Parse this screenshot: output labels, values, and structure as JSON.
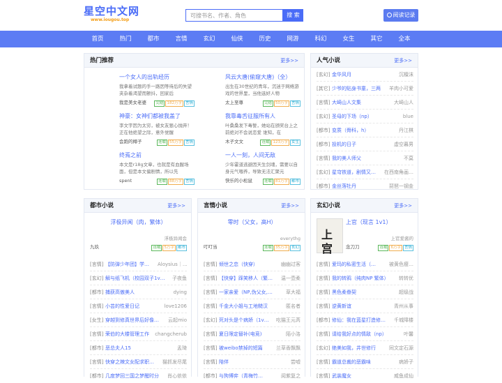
{
  "header": {
    "logo_title": "星空中文网",
    "logo_url": "www.iougou.top",
    "search_placeholder": "可搜书名、作者、角色",
    "search_button": "搜 索",
    "read_record": "阅读记录"
  },
  "nav": [
    "首页",
    "热门",
    "都市",
    "言情",
    "玄幻",
    "仙侠",
    "历史",
    "网游",
    "科幻",
    "女生",
    "其它",
    "全本"
  ],
  "hot": {
    "title": "热门推荐",
    "more": "更多>>",
    "items": [
      {
        "title": "一个女人的出轨经历",
        "desc": "我拿着试题的手一路因等待后的失望夹杂着渴望而颤抖，回家后",
        "author": "我是美女老婆",
        "tags": [
          "完结",
          "182万字",
          "言情"
        ]
      },
      {
        "title": "风云大唐(偷窥大唐)（全）",
        "desc": "出生在30世纪的青年，沉迷于网络游戏的世界里，当他选好人物",
        "author": "太上至尊",
        "tags": [
          "完结",
          "50万字",
          "言情"
        ]
      },
      {
        "title": "神豪：女神们都被我盖了",
        "desc": "李文宇因为太穷，被女友狠心抛弃！ 正在他绝望之际，意外觉醒",
        "author": "会跑的椰子",
        "tags": [
          "连载",
          "55万字",
          "言情"
        ]
      },
      {
        "title": "我靠毒舌征服所有人",
        "desc": "叶桑桑发下毒誓，她站在颁奖台上之前绝对不会说恋爱 谁知，在",
        "author": "木子文文",
        "tags": [
          "连载",
          "123万字",
          "女生"
        ]
      },
      {
        "title": "终焉之前",
        "desc": "本文是r18g文章，也就是有血腥场面，但是本文偏剧情，所以先",
        "author": "spent",
        "tags": [
          "连载",
          "88万字",
          "言情"
        ]
      },
      {
        "title": "一人一刻，人间无敌",
        "desc": "少年霍道逃避因天生剑魂，需要以自身元气喂养，导致无法汇聚元",
        "author": "快乐的小松鼠",
        "tags": [
          "连载",
          "81万字",
          "都市"
        ]
      }
    ]
  },
  "popular": {
    "title": "人气小说",
    "more": "更多>>",
    "items": [
      {
        "cat": "[玄幻]",
        "name": "金华风月",
        "author": "沉檀沫"
      },
      {
        "cat": "[其它]",
        "name": "少爷的贴身书童，三两",
        "author": "羊肉小可爱"
      },
      {
        "cat": "[言情]",
        "name": "大崎山人文集",
        "author": "大崎山人"
      },
      {
        "cat": "[玄幻]",
        "name": "圣母的下场（np）",
        "author": "blue"
      },
      {
        "cat": "[都市]",
        "name": "变质（骨科，h）",
        "author": "丹江棋"
      },
      {
        "cat": "[都市]",
        "name": "投机的日子",
        "author": "虚空暮男"
      },
      {
        "cat": "[言情]",
        "name": "我的美人师父",
        "author": "不莫"
      },
      {
        "cat": "[玄幻]",
        "name": "星穹铁道，剧情又…",
        "author": "在西南角画…"
      },
      {
        "cat": "[都市]",
        "name": "金丝落牡丹",
        "author": "琵琶一钢金"
      }
    ]
  },
  "urban": {
    "title": "都市小说",
    "more": "更多>>",
    "top_title": "浮极异闻（肉，繁体）",
    "top_author_right": "浮极异闻会",
    "top_author": "九玖",
    "top_tags": [
      "连载",
      "5万字",
      "都市"
    ],
    "items": [
      {
        "cat": "[言情]",
        "name": "【防弹少年团】学…",
        "author": "Aloysius｜…"
      },
      {
        "cat": "[玄幻]",
        "name": "解与纸飞机（校园双子1v…",
        "author": "子夜鱼"
      },
      {
        "cat": "[都市]",
        "name": "捕获高傲美人",
        "author": "dying"
      },
      {
        "cat": "[言情]",
        "name": "小芸的性爱日记",
        "author": "love1206"
      },
      {
        "cat": "[女生]",
        "name": "穿越到修真世界后好像…",
        "author": "云起mio"
      },
      {
        "cat": "[言情]",
        "name": "荣伯的大楼管理工作",
        "author": "changcherub"
      },
      {
        "cat": "[都市]",
        "name": "恶总夫人15",
        "author": "孟琦"
      },
      {
        "cat": "[言情]",
        "name": "快穿之辣文女配求职…",
        "author": "猫抓发尽尾"
      },
      {
        "cat": "[都市]",
        "name": "几度梦回三国之梦醒时分",
        "author": "肖心依依"
      }
    ]
  },
  "romance": {
    "title": "言情小说",
    "more": "更多>>",
    "top_title": "零时（父女，高H）",
    "top_author_right": "everythg",
    "top_author": "叮叮当",
    "top_tags": [
      "连载",
      "35万字",
      "玄幻"
    ],
    "items": [
      {
        "cat": "[言情]",
        "name": "倾世之恋（快穿）",
        "author": "幽幽过客"
      },
      {
        "cat": "[言情]",
        "name": "【快穿】踩笑移人（繁…",
        "author": "温一壶柔"
      },
      {
        "cat": "[言情]",
        "name": "一家亲爱（NP,伪父女,…",
        "author": "草大福"
      },
      {
        "cat": "[言情]",
        "name": "千金大小姐与工地糙汉",
        "author": "匿名者"
      },
      {
        "cat": "[玄幻]",
        "name": "死对头是个病娇（1v…",
        "author": "吃猫王元芮"
      },
      {
        "cat": "[言情]",
        "name": "夏日限定替补(电竞)",
        "author": "陌小洛"
      },
      {
        "cat": "[言情]",
        "name": "被weibo禁掉的短篇",
        "author": "兰草香飘飘"
      },
      {
        "cat": "[言情]",
        "name": "陪伴",
        "author": "尝嘘"
      },
      {
        "cat": "[都市]",
        "name": "与狗博弈（青梅竹…",
        "author": "阅紫复之"
      }
    ]
  },
  "fantasy": {
    "title": "玄幻小说",
    "more": "更多>>",
    "cover_text": "上宫",
    "top_title": "上官（现言 1v1）",
    "top_author_right": "上官爱酱的",
    "top_author": "念刀刀",
    "top_tags": [
      "连载",
      "6万字",
      "言情"
    ],
    "items": [
      {
        "cat": "[言情]",
        "name": "爱玛的私密生活（…",
        "author": "被黄色瘦…"
      },
      {
        "cat": "[言情]",
        "name": "我的转鸦（纯肉NP 繁体）",
        "author": "转转优"
      },
      {
        "cat": "[言情]",
        "name": "黑色柔眷契",
        "author": "超级战"
      },
      {
        "cat": "[言情]",
        "name": "逆黄新谊",
        "author": "青州从事"
      },
      {
        "cat": "[都市]",
        "name": "修仙：我在蓝星打造修…",
        "author": "千城障楼"
      },
      {
        "cat": "[言情]",
        "name": "请给我好点的情敌（np）",
        "author": "叶馨"
      },
      {
        "cat": "[玄幻]",
        "name": "绝美如我，井世修行",
        "author": "同文定石源"
      },
      {
        "cat": "[言情]",
        "name": "霸道总裁的恶霸味",
        "author": "病娇子"
      },
      {
        "cat": "[言情]",
        "name": "武装魔女",
        "author": "威鱼成仙"
      }
    ]
  }
}
